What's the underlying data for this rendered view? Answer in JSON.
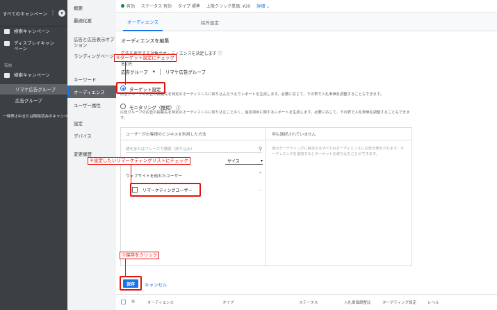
{
  "nav": {
    "all_campaigns": "すべてのキャンペーン",
    "items": [
      {
        "label": "検索キャンペーン",
        "icon": "search-campaign-icon"
      },
      {
        "label": "ディスプレイキャンペーン",
        "icon": "display-campaign-icon"
      }
    ],
    "section_enabled": "有効",
    "enabled_campaign": "検索キャンペーン",
    "ad_group_selected": "リマケ広告グループ",
    "ad_group_other": "広告グループ",
    "paused_note": "一時停止中または削除済みのキャンペーン"
  },
  "subnav": {
    "overview": "概要",
    "recommendations": "最適化案",
    "ads": "広告と広告表示オプション",
    "landing": "ランディングページ",
    "keywords": "キーワード",
    "audiences": "オーディエンス",
    "demographics": "ユーザー属性",
    "settings": "設定",
    "devices": "デバイス",
    "history": "変更履歴"
  },
  "status": {
    "state": "有効",
    "status": "ステータス 有効",
    "type": "タイプ 標準",
    "cpc": "上限クリック単価: ¥20",
    "details": "詳細"
  },
  "tabs": [
    "オーディエンス",
    "除外設定"
  ],
  "edit": {
    "heading": "オーディエンスを編集",
    "description": "広告を表示する対象のオーディエンスを決定します",
    "tracking_label": "追加先",
    "ad_group_label": "広告グループ",
    "ad_group_value": "リマケ広告グループ"
  },
  "targeting": {
    "option1": "ターゲット設定",
    "option1_desc": "広告グループの広告の掲載先を特定のオーディエンスに絞り込んだうえでレポートを生成します。必要に応じて、下の表で入札単価を調整することもできます。",
    "option2": "モニタリング（推奨）",
    "option2_desc": "広告グループの広告の掲載先を特定のオーディエンスに絞り込むことなく、追加項目に関するレポートを生成します。必要に応じて、下の表で入札単価を調整することもできます。"
  },
  "panel": {
    "left_header": "ユーザーがお客様のビジネスを利用した方法",
    "right_header": "何も選択されていません",
    "search_placeholder": "語句またはフレーズで検索（絞り込み）",
    "dropdown": "サイス",
    "web_header": "ウェブサイトを訪れたユーザー",
    "list_item": "リマーケティングユーザー",
    "list_dash": "–",
    "right_message": "他のターゲティングに該当するすべてのオーディエンスに広告が表示されます。オーディエンスを追加するとターゲットを絞り込むことができます。"
  },
  "actions": {
    "save": "保存",
    "cancel": "キャンセル"
  },
  "footer": {
    "cols": [
      "オーディエンス",
      "タイプ",
      "ステータス",
      "入札単価調整比",
      "ターゲティング設定",
      "レベル"
    ]
  },
  "annotations": {
    "step5": "⑤ターゲット設定にチェック",
    "step6": "⑥設定したいリマーケティングリストにチェック",
    "step7": "⑦保存をクリック"
  },
  "colors": {
    "accent": "#1a73e8",
    "annotation": "#e3120b",
    "nav_bg": "#3c4043"
  }
}
